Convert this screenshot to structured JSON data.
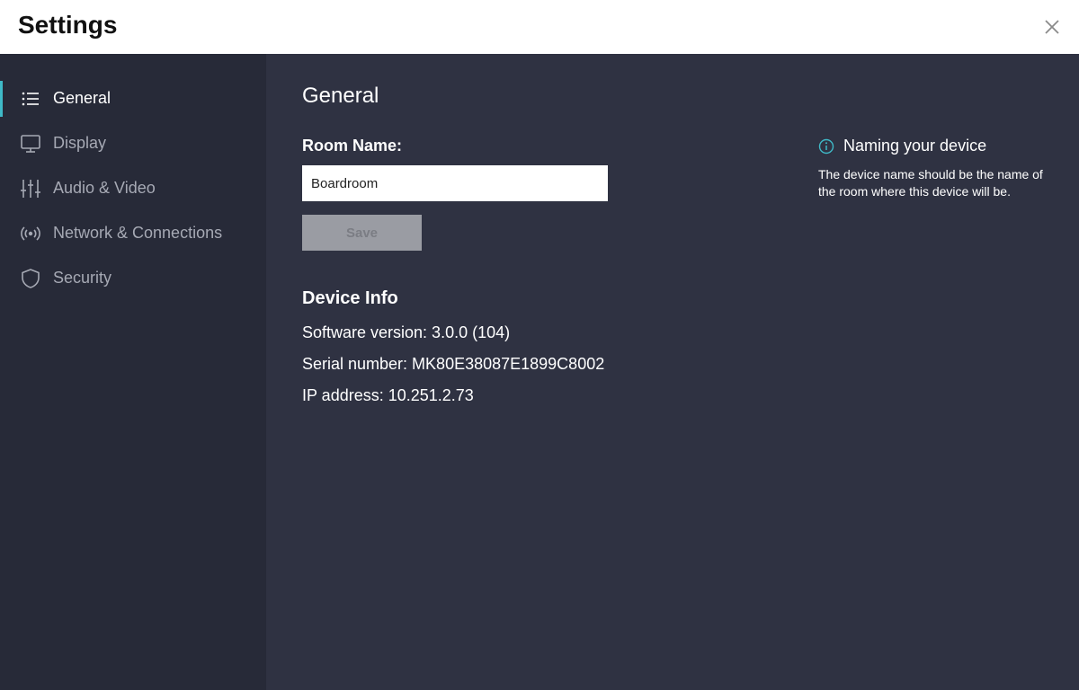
{
  "window": {
    "title": "Settings",
    "close_icon": "close-icon"
  },
  "sidebar": {
    "items": [
      {
        "label": "General",
        "icon": "list-icon",
        "active": true
      },
      {
        "label": "Display",
        "icon": "monitor-icon",
        "active": false
      },
      {
        "label": "Audio & Video",
        "icon": "sliders-icon",
        "active": false
      },
      {
        "label": "Network & Connections",
        "icon": "broadcast-icon",
        "active": false
      },
      {
        "label": "Security",
        "icon": "shield-icon",
        "active": false
      }
    ]
  },
  "main": {
    "title": "General",
    "room_name": {
      "label": "Room Name:",
      "value": "Boardroom"
    },
    "save_label": "Save",
    "device_info": {
      "title": "Device Info",
      "software_version": "Software version: 3.0.0 (104)",
      "serial_number": "Serial number: MK80E38087E1899C8002",
      "ip_address": "IP address: 10.251.2.73"
    },
    "help": {
      "title": "Naming your device",
      "text": "The device name should be the name of the room where this device will be."
    }
  },
  "colors": {
    "accent": "#3fb9c7",
    "sidebar_bg": "#272a38",
    "main_bg": "#2f3242"
  }
}
